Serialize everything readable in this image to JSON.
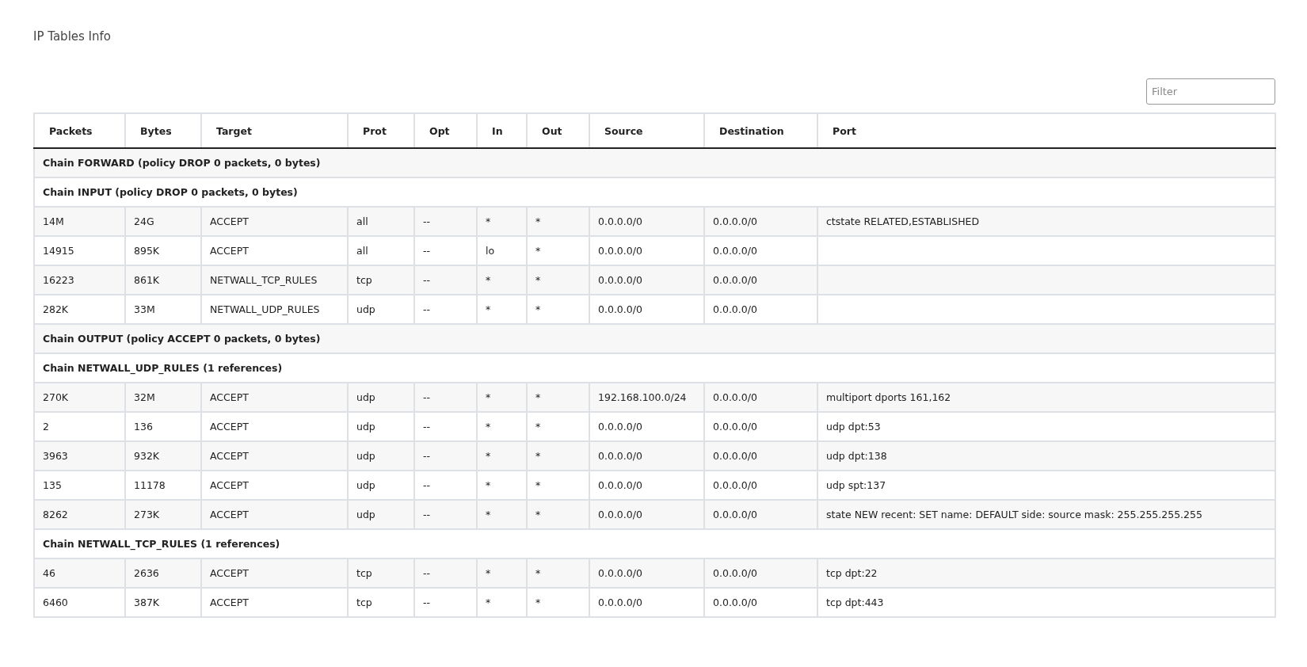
{
  "page_title": "IP Tables Info",
  "filter": {
    "placeholder": "Filter"
  },
  "table": {
    "columns": [
      "Packets",
      "Bytes",
      "Target",
      "Prot",
      "Opt",
      "In",
      "Out",
      "Source",
      "Destination",
      "Port"
    ],
    "rows": [
      {
        "kind": "chain",
        "text": "Chain FORWARD (policy DROP 0 packets, 0 bytes)"
      },
      {
        "kind": "chain",
        "text": "Chain INPUT (policy DROP 0 packets, 0 bytes)"
      },
      {
        "kind": "rule",
        "cells": [
          "14M",
          "24G",
          "ACCEPT",
          "all",
          "--",
          "*",
          "*",
          "0.0.0.0/0",
          "0.0.0.0/0",
          "ctstate RELATED,ESTABLISHED"
        ]
      },
      {
        "kind": "rule",
        "cells": [
          "14915",
          "895K",
          "ACCEPT",
          "all",
          "--",
          "lo",
          "*",
          "0.0.0.0/0",
          "0.0.0.0/0",
          ""
        ]
      },
      {
        "kind": "rule",
        "cells": [
          "16223",
          "861K",
          "NETWALL_TCP_RULES",
          "tcp",
          "--",
          "*",
          "*",
          "0.0.0.0/0",
          "0.0.0.0/0",
          ""
        ]
      },
      {
        "kind": "rule",
        "cells": [
          "282K",
          "33M",
          "NETWALL_UDP_RULES",
          "udp",
          "--",
          "*",
          "*",
          "0.0.0.0/0",
          "0.0.0.0/0",
          ""
        ]
      },
      {
        "kind": "chain",
        "text": "Chain OUTPUT (policy ACCEPT 0 packets, 0 bytes)"
      },
      {
        "kind": "chain",
        "text": "Chain NETWALL_UDP_RULES (1 references)"
      },
      {
        "kind": "rule",
        "cells": [
          "270K",
          "32M",
          "ACCEPT",
          "udp",
          "--",
          "*",
          "*",
          "192.168.100.0/24",
          "0.0.0.0/0",
          "multiport dports 161,162"
        ]
      },
      {
        "kind": "rule",
        "cells": [
          "2",
          "136",
          "ACCEPT",
          "udp",
          "--",
          "*",
          "*",
          "0.0.0.0/0",
          "0.0.0.0/0",
          "udp dpt:53"
        ]
      },
      {
        "kind": "rule",
        "cells": [
          "3963",
          "932K",
          "ACCEPT",
          "udp",
          "--",
          "*",
          "*",
          "0.0.0.0/0",
          "0.0.0.0/0",
          "udp dpt:138"
        ]
      },
      {
        "kind": "rule",
        "cells": [
          "135",
          "11178",
          "ACCEPT",
          "udp",
          "--",
          "*",
          "*",
          "0.0.0.0/0",
          "0.0.0.0/0",
          "udp spt:137"
        ]
      },
      {
        "kind": "rule",
        "cells": [
          "8262",
          "273K",
          "ACCEPT",
          "udp",
          "--",
          "*",
          "*",
          "0.0.0.0/0",
          "0.0.0.0/0",
          "state NEW recent: SET name: DEFAULT side: source mask: 255.255.255.255"
        ]
      },
      {
        "kind": "chain",
        "text": "Chain NETWALL_TCP_RULES (1 references)"
      },
      {
        "kind": "rule",
        "cells": [
          "46",
          "2636",
          "ACCEPT",
          "tcp",
          "--",
          "*",
          "*",
          "0.0.0.0/0",
          "0.0.0.0/0",
          "tcp dpt:22"
        ]
      },
      {
        "kind": "rule",
        "cells": [
          "6460",
          "387K",
          "ACCEPT",
          "tcp",
          "--",
          "*",
          "*",
          "0.0.0.0/0",
          "0.0.0.0/0",
          "tcp dpt:443"
        ]
      }
    ]
  }
}
